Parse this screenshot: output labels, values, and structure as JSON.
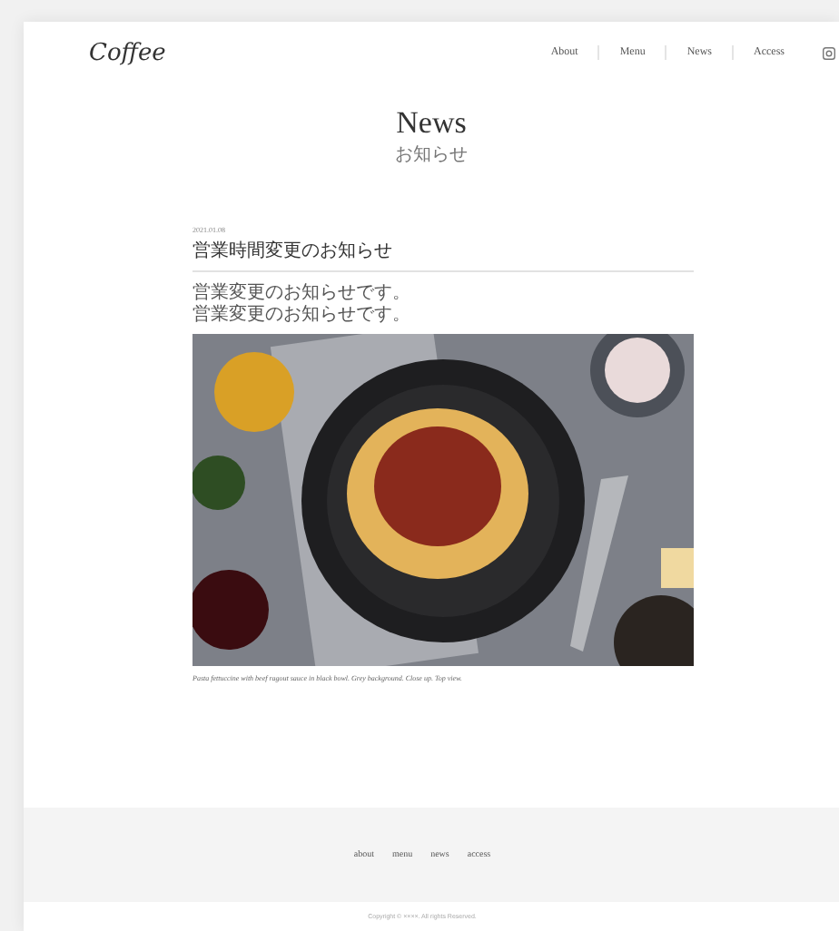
{
  "header": {
    "logo": "Coffee",
    "nav": [
      "About",
      "Menu",
      "News",
      "Access"
    ]
  },
  "page_title": {
    "title": "News",
    "subtitle": "お知らせ"
  },
  "article": {
    "date": "2021.01.08",
    "title": "営業時間変更のお知らせ",
    "paragraphs": [
      "営業変更のお知らせです。",
      "営業変更のお知らせです。"
    ],
    "caption": "Pasta fettuccine with beef ragout sauce in black bowl. Grey background. Close up. Top view."
  },
  "footer": {
    "links": [
      "about",
      "menu",
      "news",
      "access"
    ],
    "copyright": "Copyright © ××××. All rights Reserved."
  }
}
